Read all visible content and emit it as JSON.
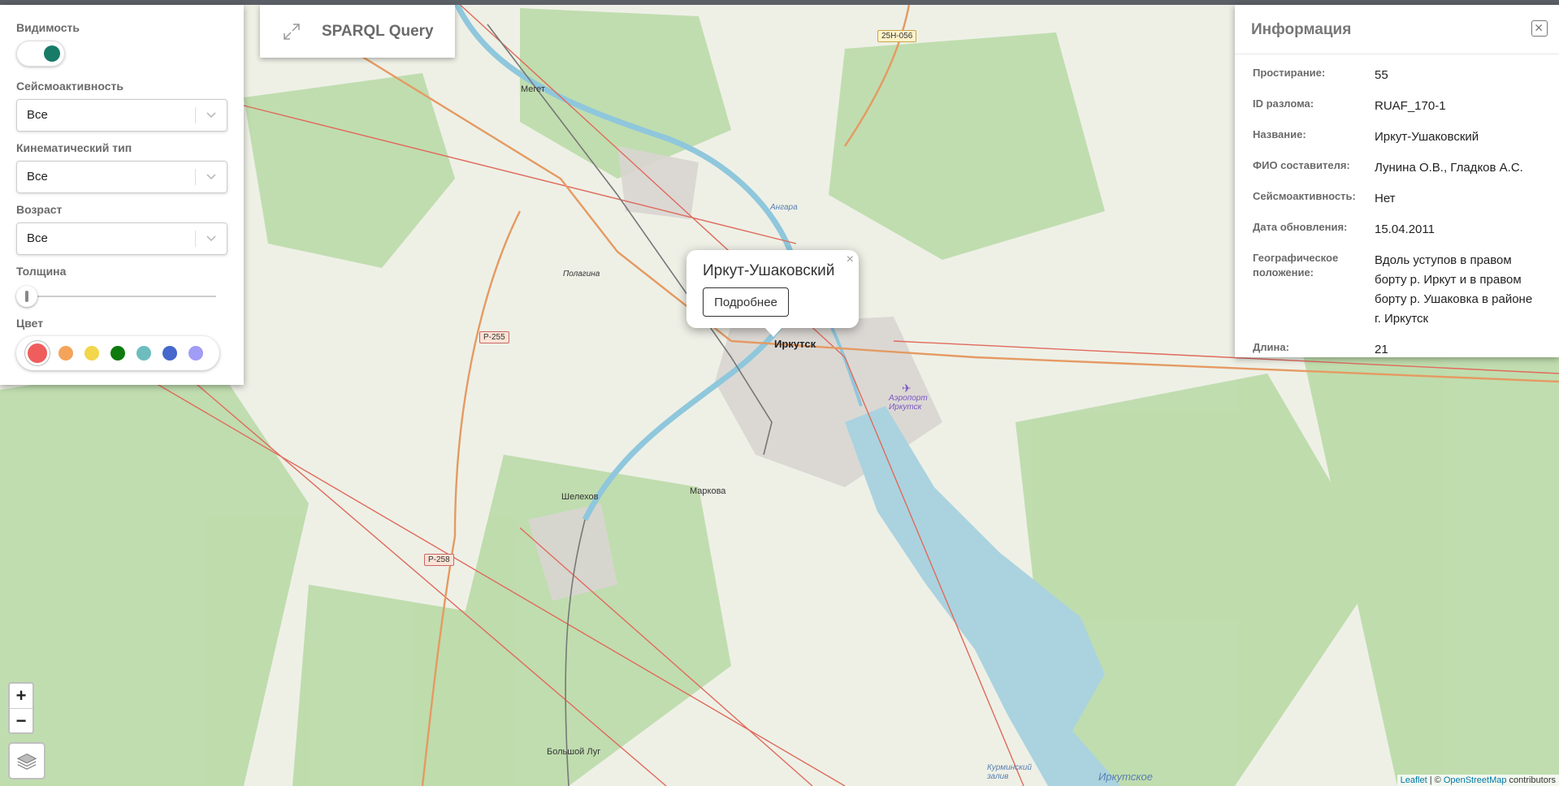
{
  "filters": {
    "visibility_label": "Видимость",
    "visibility_on": true,
    "seismic_label": "Сейсмоактивность",
    "seismic_value": "Все",
    "kinematic_label": "Кинематический тип",
    "kinematic_value": "Все",
    "age_label": "Возраст",
    "age_value": "Все",
    "thickness_label": "Толщина",
    "color_label": "Цвет",
    "colors": [
      "#ef5d5d",
      "#f4a45a",
      "#f2d64c",
      "#0e7a0e",
      "#6dbdbf",
      "#4667cb",
      "#a19cf5"
    ],
    "selected_color": "#ef5d5d"
  },
  "sparql": {
    "label": "SPARQL Query"
  },
  "info": {
    "title": "Информация",
    "rows": [
      {
        "key": "Простирание:",
        "value": "55"
      },
      {
        "key": "ID разлома:",
        "value": "RUAF_170-1"
      },
      {
        "key": "Название:",
        "value": "Иркут-Ушаковский"
      },
      {
        "key": "ФИО составителя:",
        "value": "Лунина О.В., Гладков А.С."
      },
      {
        "key": "Сейсмоактивность:",
        "value": "Нет"
      },
      {
        "key": "Дата обновления:",
        "value": "15.04.2011"
      },
      {
        "key": "Географическое положение:",
        "value": "Вдоль уступов в правом борту р. Иркут и в правом борту р. Ушаковка в районе г. Иркутск"
      },
      {
        "key": "Длина:",
        "value": "21"
      }
    ]
  },
  "popup": {
    "title": "Иркут-Ушаковский",
    "button": "Подробнее",
    "close": "×"
  },
  "zoom": {
    "in": "+",
    "out": "−"
  },
  "attribution": {
    "leaflet": "Leaflet",
    "sep": " | © ",
    "osm": "OpenStreetMap",
    "suffix": " contributors"
  },
  "map_labels": {
    "irkutsk": "Иркутск",
    "megat": "Мегет",
    "shelekhov": "Шелехов",
    "markova": "Маркова",
    "bolshoy_lug": "Большой Луг",
    "airport": "Аэропорт Иркутск",
    "angara": "Ангара",
    "pologina": "Полагина",
    "r255": "Р-255",
    "r258": "Р-258",
    "r25n056": "25Н-056",
    "kurminsky": "Курминский залив",
    "irkutskoe": "Иркутское"
  }
}
